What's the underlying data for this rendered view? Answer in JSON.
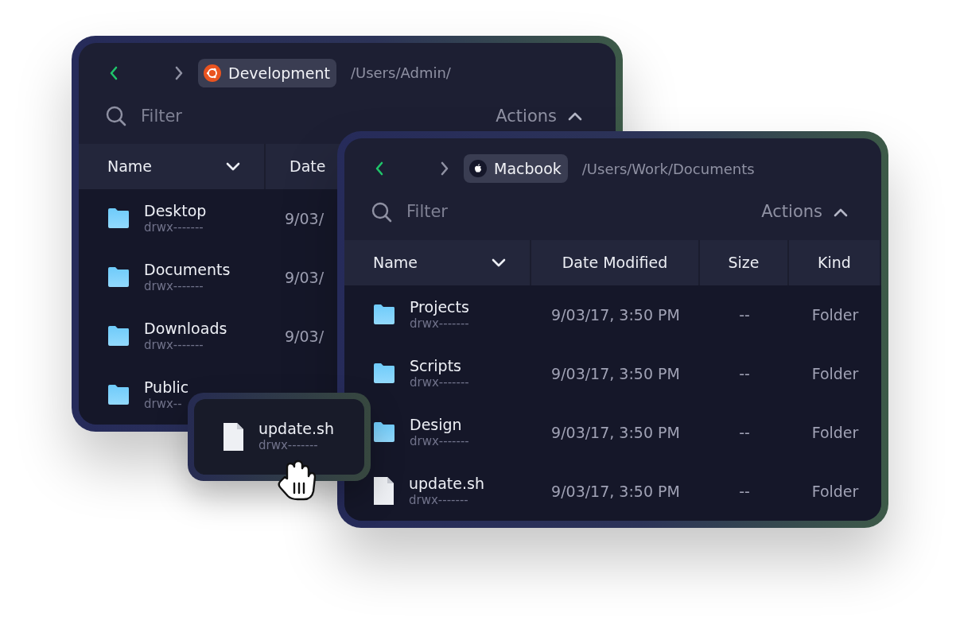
{
  "windows": [
    {
      "location": "Development",
      "path": "/Users/Admin/",
      "filter": {
        "placeholder": "Filter"
      },
      "actions": "Actions",
      "columns": [
        "Name",
        "Date"
      ],
      "rows": [
        {
          "kind": "folder",
          "name": "Desktop",
          "permissions": "drwx-------",
          "date": "9/03/"
        },
        {
          "kind": "folder",
          "name": "Documents",
          "permissions": "drwx-------",
          "date": "9/03/"
        },
        {
          "kind": "folder",
          "name": "Downloads",
          "permissions": "drwx-------",
          "date": "9/03/"
        },
        {
          "kind": "folder",
          "name": "Public",
          "permissions": "drwx--"
        }
      ]
    },
    {
      "location": "Macbook",
      "path": "/Users/Work/Documents",
      "filter": {
        "placeholder": "Filter"
      },
      "actions": "Actions",
      "columns": [
        "Name",
        "Date Modified",
        "Size",
        "Kind"
      ],
      "rows": [
        {
          "kind": "folder",
          "name": "Projects",
          "permissions": "drwx-------",
          "date": "9/03/17, 3:50 PM",
          "size": "--",
          "type_label": "Folder"
        },
        {
          "kind": "folder",
          "name": "Scripts",
          "permissions": "drwx-------",
          "date": "9/03/17, 3:50 PM",
          "size": "--",
          "type_label": "Folder"
        },
        {
          "kind": "folder",
          "name": "Design",
          "permissions": "drwx-------",
          "date": "9/03/17, 3:50 PM",
          "size": "--",
          "type_label": "Folder"
        },
        {
          "kind": "file",
          "name": "update.sh",
          "permissions": "drwx-------",
          "date": "9/03/17, 3:50 PM",
          "size": "--",
          "type_label": "Folder"
        }
      ]
    }
  ],
  "dragged_item": {
    "kind": "file",
    "name": "update.sh",
    "permissions": "drwx-------"
  }
}
